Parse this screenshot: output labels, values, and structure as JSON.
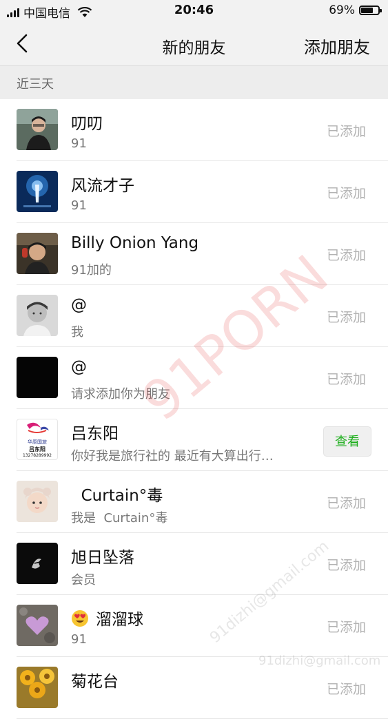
{
  "status_bar": {
    "carrier": "中国电信",
    "time": "20:46",
    "battery": "69%",
    "battery_level": 0.69
  },
  "nav": {
    "title": "新的朋友",
    "action": "添加朋友"
  },
  "section": {
    "label": "近三天"
  },
  "contacts": [
    {
      "name": "叨叨",
      "sub": "91",
      "status": "已添加"
    },
    {
      "name": "风流才子",
      "sub": "91",
      "status": "已添加"
    },
    {
      "name": "Billy Onion Yang",
      "sub": "91加的",
      "status": "已添加"
    },
    {
      "name": "@",
      "sub": "我",
      "status": "已添加"
    },
    {
      "name": "@",
      "sub": "请求添加你为朋友",
      "status": "已添加"
    },
    {
      "name": "吕东阳",
      "sub": "你好我是旅行社的  最近有大算出行…",
      "status": "查看",
      "avatar_text_1": "华原国旅",
      "avatar_text_2": "吕东阳",
      "avatar_text_3": "13278289992"
    },
    {
      "name": "  Curtain°毒",
      "sub": "我是  Curtain°毒",
      "status": "已添加"
    },
    {
      "name": "旭日坠落",
      "sub": "会员",
      "status": "已添加"
    },
    {
      "name": "溜溜球",
      "sub": "91",
      "status": "已添加",
      "emoji": "heart-eyes-emoji"
    },
    {
      "name": "菊花台",
      "sub": "",
      "status": "已添加"
    }
  ],
  "watermark": {
    "main": "91PORN",
    "email": "91dizhi@gmail.com",
    "email_footer": "91dizhi@gmail.com"
  },
  "colors": {
    "accent_green": "#1aad19",
    "muted": "#b2b2b2",
    "nav_bg": "#f2f2f2"
  }
}
